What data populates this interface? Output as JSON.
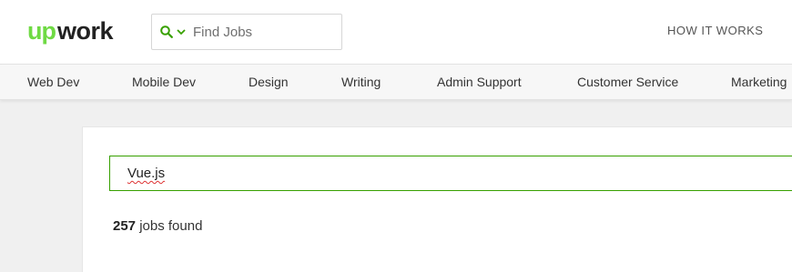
{
  "brand": {
    "name": "upwork",
    "color": "#6fda44",
    "text_color": "#222222"
  },
  "header": {
    "search_placeholder": "Find Jobs",
    "search_icon": "search-icon",
    "dropdown_icon": "chevron-down-icon",
    "how_it_works_label": "HOW IT WORKS"
  },
  "categories": [
    "Web Dev",
    "Mobile Dev",
    "Design",
    "Writing",
    "Admin Support",
    "Customer Service",
    "Marketing"
  ],
  "main": {
    "query_value": "Vue.js",
    "results_count": "257",
    "results_suffix": "jobs found"
  },
  "colors": {
    "accent": "#37a000",
    "logo_green": "#6fda44"
  }
}
